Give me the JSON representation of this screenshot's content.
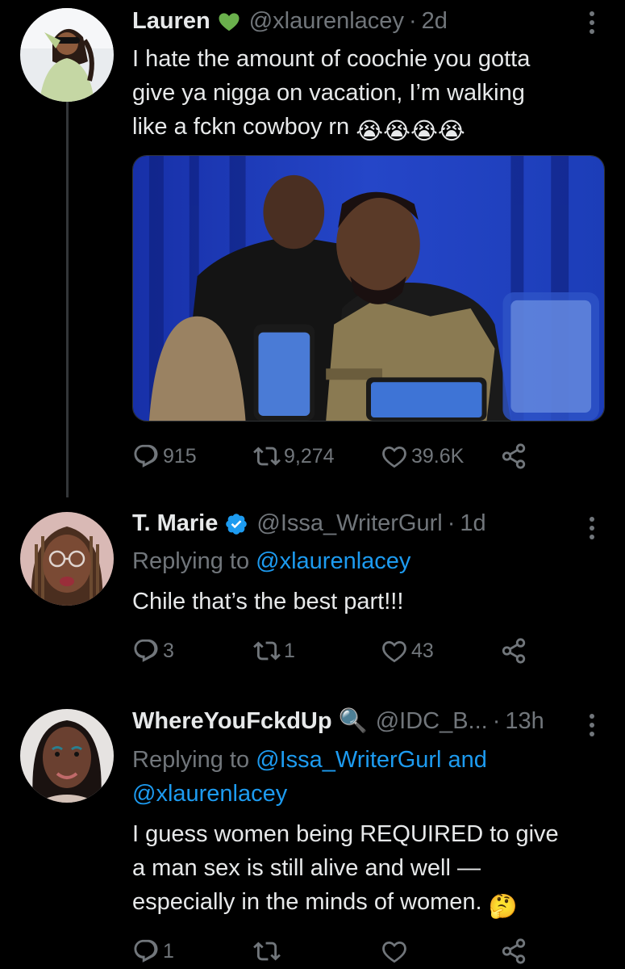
{
  "tweets": [
    {
      "name": "Lauren",
      "handle": "@xlaurenlacey",
      "time": "2d",
      "text_lines": [
        "I hate the amount of coochie you gotta",
        "give ya nigga on vacation, I’m walking",
        "like a fckn cowboy rn"
      ],
      "emoji_suffix": "😭😭😭😭",
      "stats": {
        "replies": "915",
        "retweets": "9,274",
        "likes": "39.6K"
      }
    },
    {
      "name": "T. Marie",
      "handle": "@Issa_WriterGurl",
      "time": "1d",
      "reply_prefix": "Replying to",
      "reply_mentions": "@xlaurenlacey",
      "text_lines": [
        "Chile that’s the best part!!!"
      ],
      "stats": {
        "replies": "3",
        "retweets": "1",
        "likes": "43"
      }
    },
    {
      "name": "WhereYouFckdUp",
      "name_emoji": "🔍",
      "handle": "@IDC_B...",
      "time": "13h",
      "reply_prefix": "Replying to",
      "reply_mention_1": "@Issa_WriterGurl and",
      "reply_mention_2": "@xlaurenlacey",
      "text_lines": [
        "I guess women being REQUIRED to give",
        "a man sex is still alive and well —",
        "especially in the minds of women."
      ],
      "emoji_suffix": "🤔",
      "stats": {
        "replies": "1",
        "retweets": "",
        "likes": ""
      }
    }
  ],
  "colors": {
    "background": "#000000",
    "text": "#e7e9ea",
    "muted": "#71767b",
    "link": "#1d9bf0",
    "verified": "#1d9bf0",
    "heart_badge": "#6ab04c"
  },
  "icons": [
    "reply-icon",
    "retweet-icon",
    "like-icon",
    "share-icon",
    "more-icon",
    "verified-badge-icon",
    "green-heart-icon"
  ]
}
